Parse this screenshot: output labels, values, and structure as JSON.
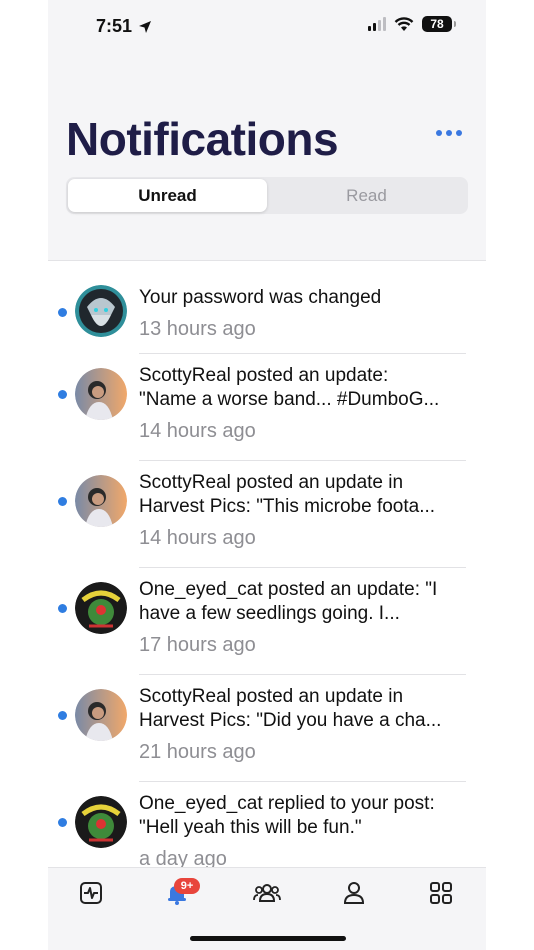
{
  "status_bar": {
    "time": "7:51",
    "battery": "78"
  },
  "header": {
    "title": "Notifications"
  },
  "segments": {
    "unread_label": "Unread",
    "read_label": "Read",
    "selected": "Unread"
  },
  "notifications": [
    {
      "avatar": "wizard-avatar",
      "message_line1": "Your password was changed",
      "message_line2": "",
      "time": "13 hours ago",
      "unread": true
    },
    {
      "avatar": "scottyreal-avatar",
      "message_line1": "ScottyReal posted an update:",
      "message_line2": "\"Name a worse band... #DumboG...",
      "time": "14 hours ago",
      "unread": true
    },
    {
      "avatar": "scottyreal-avatar",
      "message_line1": "ScottyReal posted an update in",
      "message_line2": "Harvest Pics: \"This microbe foota...",
      "time": "14 hours ago",
      "unread": true
    },
    {
      "avatar": "one-eyed-cat-avatar",
      "message_line1": "One_eyed_cat posted an update: \"I",
      "message_line2": "have a few seedlings going. I...",
      "time": "17 hours ago",
      "unread": true
    },
    {
      "avatar": "scottyreal-avatar",
      "message_line1": "ScottyReal posted an update in",
      "message_line2": "Harvest Pics: \"Did you have a cha...",
      "time": "21 hours ago",
      "unread": true
    },
    {
      "avatar": "one-eyed-cat-avatar",
      "message_line1": "One_eyed_cat replied to your post:",
      "message_line2": "\"Hell yeah this will be fun.\"",
      "time": "a day ago",
      "unread": true
    }
  ],
  "tabbar": {
    "notifications_badge": "9+"
  },
  "colors": {
    "accent": "#2f7de1",
    "title": "#1f1d47",
    "badge": "#e8453c"
  }
}
